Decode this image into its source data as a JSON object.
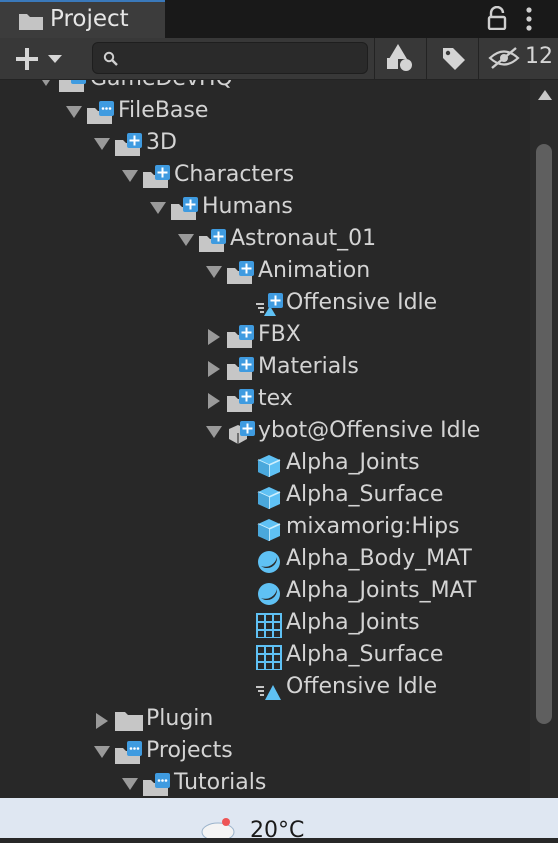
{
  "window": {
    "tab_label": "Project"
  },
  "toolbar": {
    "search_placeholder": "",
    "hidden_count": "12"
  },
  "tree": [
    {
      "label": "GameDevHQ",
      "depth": 0,
      "icon": "folder-package-icon",
      "state": "expanded"
    },
    {
      "label": "FileBase",
      "depth": 1,
      "icon": "folder-package-icon",
      "state": "expanded"
    },
    {
      "label": "3D",
      "depth": 2,
      "icon": "folder-plus-icon",
      "state": "expanded"
    },
    {
      "label": "Characters",
      "depth": 3,
      "icon": "folder-plus-icon",
      "state": "expanded"
    },
    {
      "label": "Humans",
      "depth": 4,
      "icon": "folder-plus-icon",
      "state": "expanded"
    },
    {
      "label": "Astronaut_01",
      "depth": 5,
      "icon": "folder-plus-icon",
      "state": "expanded"
    },
    {
      "label": "Animation",
      "depth": 6,
      "icon": "folder-plus-icon",
      "state": "expanded"
    },
    {
      "label": "Offensive Idle",
      "depth": 7,
      "icon": "animation-clip-plus-icon",
      "state": "leaf"
    },
    {
      "label": "FBX",
      "depth": 6,
      "icon": "folder-plus-icon",
      "state": "collapsed"
    },
    {
      "label": "Materials",
      "depth": 6,
      "icon": "folder-plus-icon",
      "state": "collapsed"
    },
    {
      "label": "tex",
      "depth": 6,
      "icon": "folder-plus-icon",
      "state": "collapsed"
    },
    {
      "label": "ybot@Offensive Idle",
      "depth": 6,
      "icon": "model-prefab-plus-icon",
      "state": "expanded"
    },
    {
      "label": "Alpha_Joints",
      "depth": 7,
      "icon": "mesh-cube-icon",
      "state": "leaf"
    },
    {
      "label": "Alpha_Surface",
      "depth": 7,
      "icon": "mesh-cube-icon",
      "state": "leaf"
    },
    {
      "label": "mixamorig:Hips",
      "depth": 7,
      "icon": "mesh-cube-icon",
      "state": "leaf"
    },
    {
      "label": "Alpha_Body_MAT",
      "depth": 7,
      "icon": "material-sphere-icon",
      "state": "leaf"
    },
    {
      "label": "Alpha_Joints_MAT",
      "depth": 7,
      "icon": "material-sphere-icon",
      "state": "leaf"
    },
    {
      "label": "Alpha_Joints",
      "depth": 7,
      "icon": "mesh-grid-icon",
      "state": "leaf"
    },
    {
      "label": "Alpha_Surface",
      "depth": 7,
      "icon": "mesh-grid-icon",
      "state": "leaf"
    },
    {
      "label": "Offensive Idle",
      "depth": 7,
      "icon": "animation-clip-icon",
      "state": "leaf"
    },
    {
      "label": "Plugin",
      "depth": 2,
      "icon": "folder-icon",
      "state": "collapsed"
    },
    {
      "label": "Projects",
      "depth": 2,
      "icon": "folder-package-icon",
      "state": "expanded"
    },
    {
      "label": "Tutorials",
      "depth": 3,
      "icon": "folder-package-icon",
      "state": "expanded"
    }
  ],
  "taskbar": {
    "weather_temp": "20°C"
  },
  "colors": {
    "accent": "#3a79bb",
    "icon_blue": "#5fc1f4",
    "background": "#282828"
  }
}
